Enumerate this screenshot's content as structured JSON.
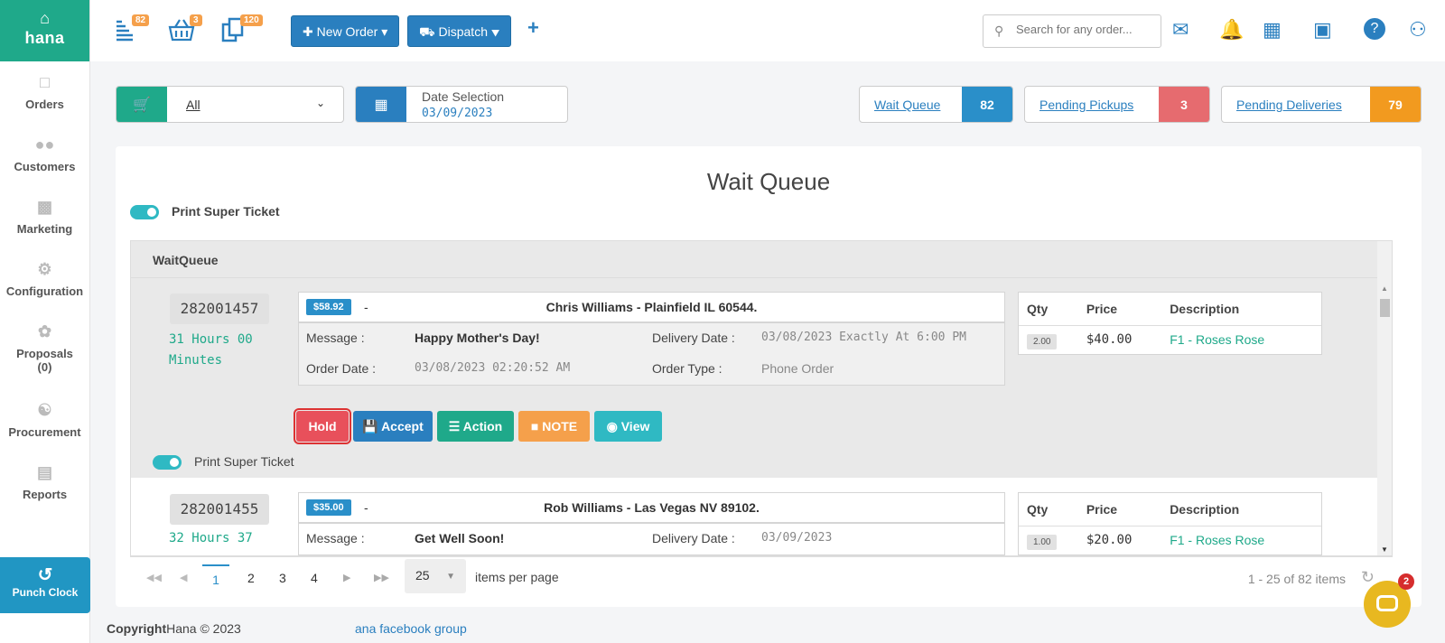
{
  "brand": {
    "name": "hana"
  },
  "sidebar": {
    "items": [
      {
        "label": "Orders",
        "icon": "orders-icon"
      },
      {
        "label": "Customers",
        "icon": "customers-icon"
      },
      {
        "label": "Marketing",
        "icon": "marketing-icon"
      },
      {
        "label": "Configuration",
        "icon": "gear-icon"
      },
      {
        "label": "Proposals",
        "sub": "(0)",
        "icon": "proposals-icon"
      },
      {
        "label": "Procurement",
        "icon": "procurement-icon"
      },
      {
        "label": "Reports",
        "icon": "reports-icon"
      }
    ],
    "punch_clock": "Punch Clock"
  },
  "header": {
    "badges": {
      "orders": "82",
      "basket": "3",
      "copies": "120"
    },
    "new_order": "New Order",
    "dispatch": "Dispatch",
    "search_placeholder": "Search for any order..."
  },
  "filter": {
    "value": "All"
  },
  "date_selection": {
    "label": "Date Selection",
    "value": "03/09/2023"
  },
  "stats": {
    "wait_queue": {
      "label": "Wait Queue",
      "count": "82",
      "color": "#2a8fc9"
    },
    "pending_pickups": {
      "label": "Pending Pickups",
      "count": "3",
      "color": "#e66b6f"
    },
    "pending_deliveries": {
      "label": "Pending Deliveries",
      "count": "79",
      "color": "#f29a1f"
    }
  },
  "main": {
    "title": "Wait Queue",
    "print_super_ticket": "Print Super Ticket",
    "queue_header": "WaitQueue"
  },
  "orders": [
    {
      "number": "282001457",
      "duration": "31 Hours 00 Minutes",
      "price": "$58.92",
      "dash": "-",
      "customer": "Chris Williams - Plainfield IL 60544.",
      "message_label": "Message :",
      "message": "Happy Mother's Day!",
      "delivery_label": "Delivery Date :",
      "delivery": "03/08/2023 Exactly At 6:00 PM",
      "order_date_label": "Order Date :",
      "order_date": "03/08/2023 02:20:52 AM",
      "order_type_label": "Order Type :",
      "order_type": "Phone Order",
      "items_headers": [
        "Qty",
        "Price",
        "Description"
      ],
      "items": [
        {
          "qty": "2.00",
          "price": "$40.00",
          "desc": "F1 - Roses Rose"
        }
      ],
      "actions": {
        "hold": "Hold",
        "accept": "Accept",
        "action": "Action",
        "note": "NOTE",
        "view": "View"
      },
      "print_super_ticket": "Print Super Ticket"
    },
    {
      "number": "282001455",
      "duration": "32 Hours 37",
      "price": "$35.00",
      "dash": "-",
      "customer": "Rob Williams - Las Vegas NV 89102.",
      "message_label": "Message :",
      "message": "Get Well Soon!",
      "delivery_label": "Delivery Date :",
      "delivery": "03/09/2023",
      "items_headers": [
        "Qty",
        "Price",
        "Description"
      ],
      "items": [
        {
          "qty": "1.00",
          "price": "$20.00",
          "desc": "F1 - Roses Rose"
        }
      ]
    }
  ],
  "pager": {
    "pages": [
      "1",
      "2",
      "3",
      "4"
    ],
    "page_size": "25",
    "items_per_page": "items per page",
    "range": "1 - 25 of 82 items"
  },
  "footer": {
    "copyright_bold": "Copyright",
    "copyright": "Hana © 2023",
    "link": "ana facebook group"
  },
  "chat": {
    "badge": "2"
  }
}
